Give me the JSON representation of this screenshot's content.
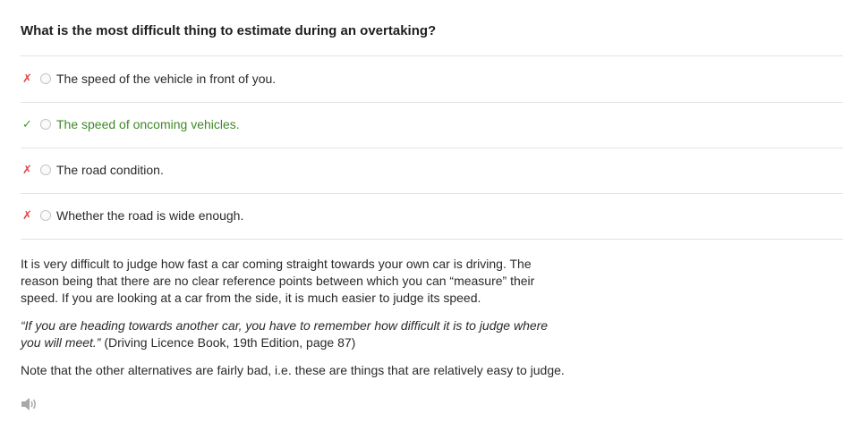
{
  "question": "What is the most difficult thing to estimate during an overtaking?",
  "options": [
    {
      "label": "The speed of the vehicle in front of you.",
      "mark": "✗",
      "status": "wrong"
    },
    {
      "label": "The speed of oncoming vehicles.",
      "mark": "✓",
      "status": "correct"
    },
    {
      "label": "The road condition.",
      "mark": "✗",
      "status": "wrong"
    },
    {
      "label": "Whether the road is wide enough.",
      "mark": "✗",
      "status": "wrong"
    }
  ],
  "explanation": {
    "paragraph1": "It is very difficult to judge how fast a car coming straight towards your own car is driving. The reason being that there are no clear reference points between which you can “measure” their speed. If you are looking at a car from the side, it is much easier to judge its speed.",
    "quote": "“If you are heading towards another car, you have to remember how difficult it is to judge where you will meet.”",
    "citation": " (Driving Licence Book, 19th Edition, page 87)",
    "paragraph3": "Note that the other alternatives are fairly bad, i.e. these are things that are relatively easy to judge."
  },
  "audio_icon": "speaker-icon",
  "colors": {
    "wrong": "#e0484a",
    "correct": "#3f8a26",
    "divider": "#e3e3e3"
  }
}
